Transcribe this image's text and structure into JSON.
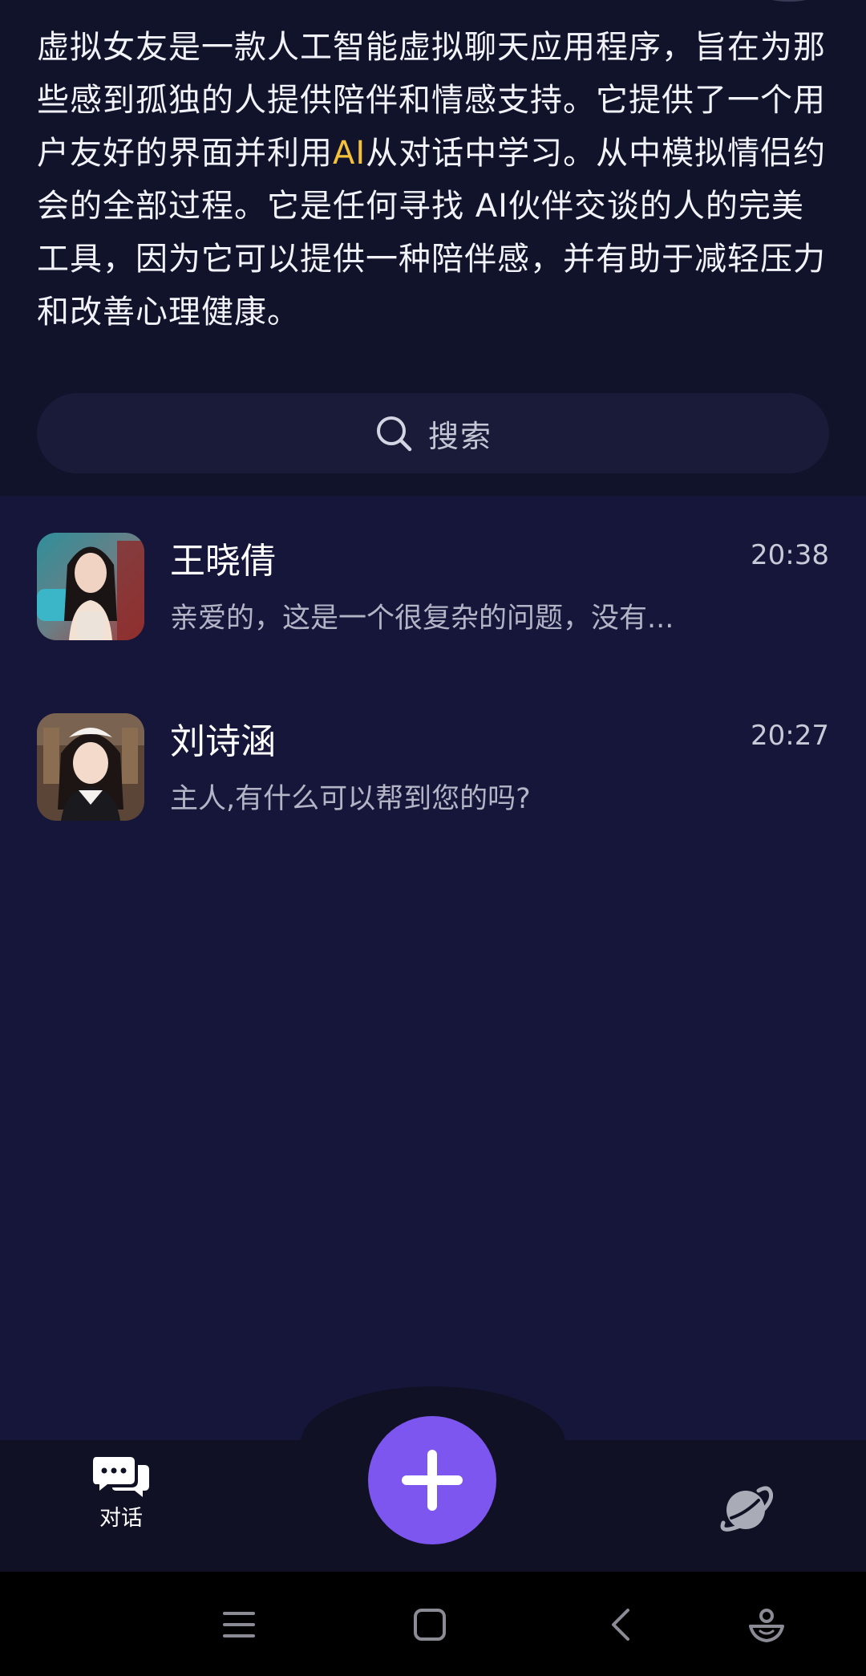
{
  "intro": {
    "text_before": "虚拟女友是一款人工智能虚拟聊天应用程序，旨在为那些感到孤独的人提供陪伴和情感支持。它提供了一个用户友好的界面并利用",
    "text_highlight": "AI",
    "text_after": "从对话中学习。从中模拟情侣约会的全部过程。它是任何寻找 AI伙伴交谈的人的完美工具，因为它可以提供一种陪伴感，并有助于减轻压力和改善心理健康。"
  },
  "search": {
    "placeholder": "搜索",
    "icon": "search-icon"
  },
  "chats": [
    {
      "name": "王晓倩",
      "preview": "亲爱的，这是一个很复杂的问题，没有...",
      "time": "20:38"
    },
    {
      "name": "刘诗涵",
      "preview": "主人,有什么可以帮到您的吗?",
      "time": "20:27"
    }
  ],
  "tabbar": {
    "chat_label": "对话",
    "chat_icon": "chat-bubbles-icon",
    "add_icon": "plus-icon",
    "discover_icon": "planet-icon"
  },
  "system_nav": {
    "icons": [
      "menu-icon",
      "home-icon",
      "back-icon",
      "assistant-icon"
    ]
  },
  "colors": {
    "background": "#16163a",
    "intro_background": "#11132b",
    "accent": "#7c56ee",
    "highlight": "#f3c13a"
  }
}
